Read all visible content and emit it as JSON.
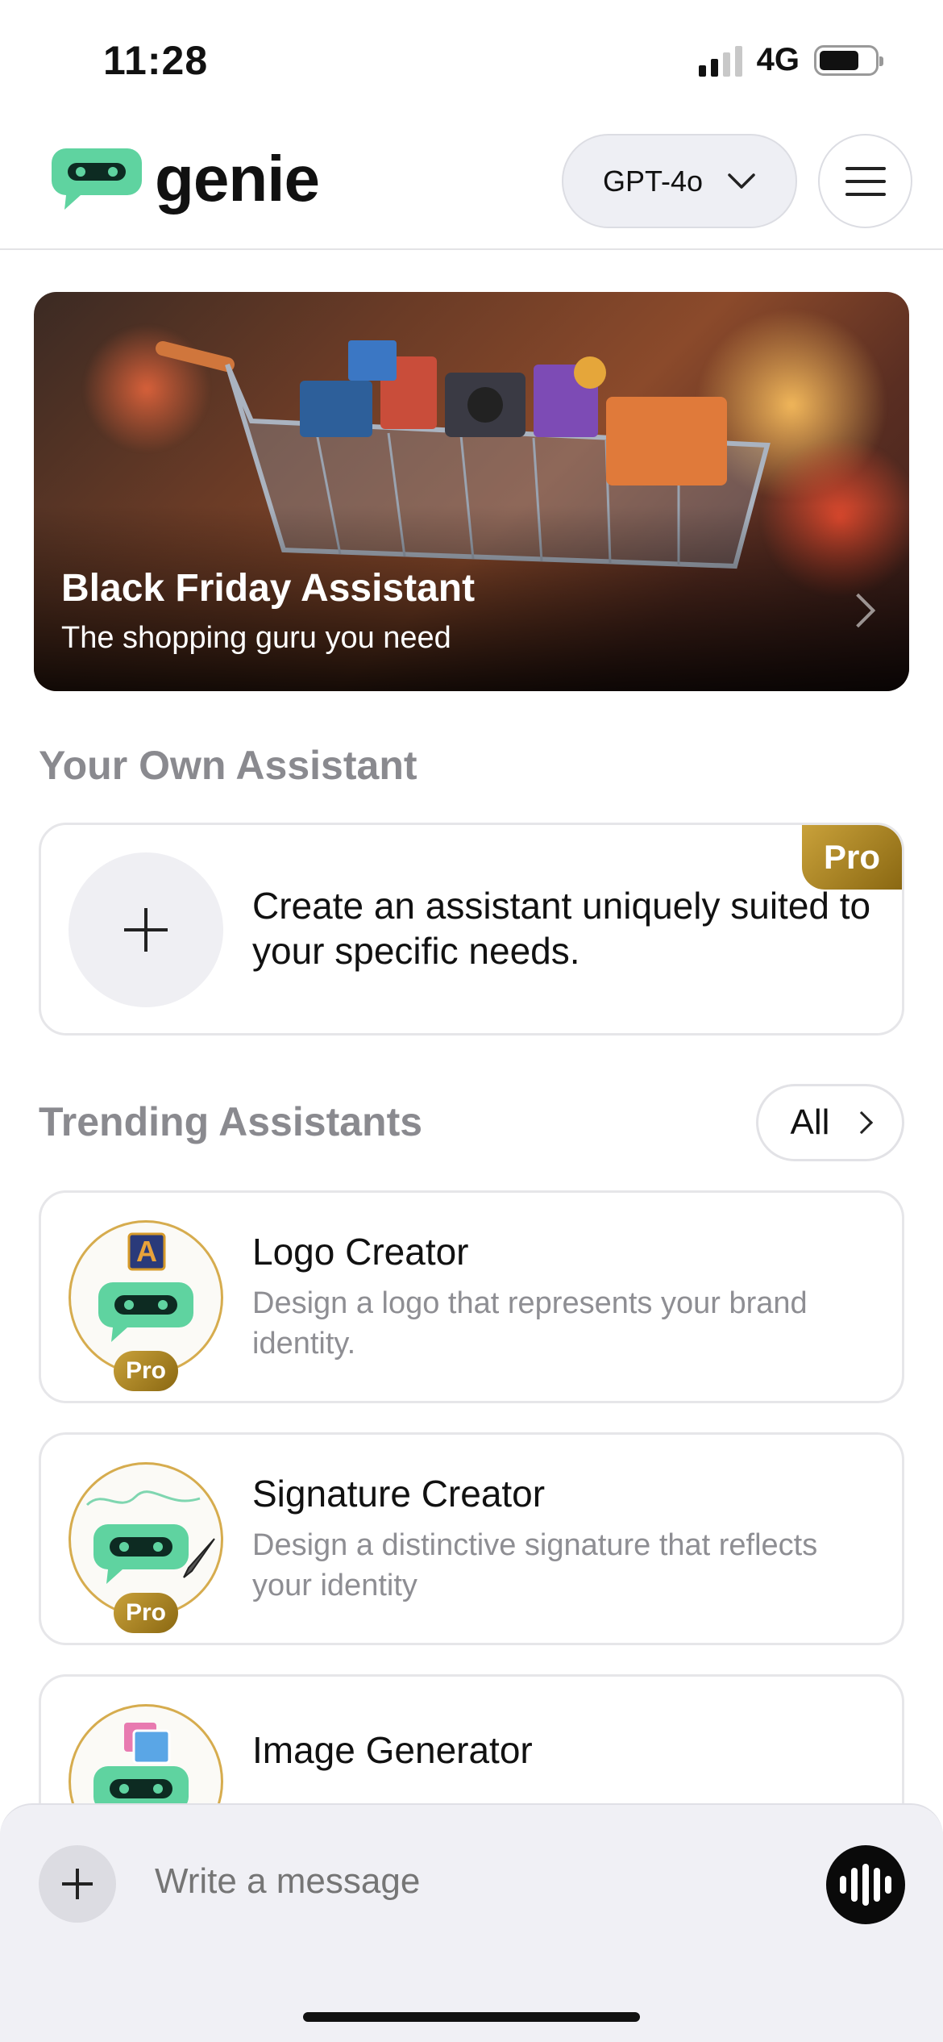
{
  "status_bar": {
    "time": "11:28",
    "network": "4G"
  },
  "header": {
    "app_name": "genie",
    "model_label": "GPT-4o"
  },
  "banner": {
    "title": "Black Friday Assistant",
    "subtitle": "The shopping guru you need"
  },
  "own_assistant": {
    "section_title": "Your Own Assistant",
    "create_text": "Create an assistant uniquely suited to your specific needs.",
    "badge": "Pro"
  },
  "trending": {
    "section_title": "Trending Assistants",
    "all_label": "All",
    "items": [
      {
        "title": "Logo Creator",
        "description": "Design a logo that represents your brand identity.",
        "badge": "Pro"
      },
      {
        "title": "Signature Creator",
        "description": "Design a distinctive signature that reflects your identity",
        "badge": "Pro"
      },
      {
        "title": "Image Generator",
        "description": ""
      }
    ]
  },
  "composer": {
    "placeholder": "Write a message"
  },
  "colors": {
    "brand_green": "#5fd3a0",
    "pro_gold": "#b88d2a"
  }
}
